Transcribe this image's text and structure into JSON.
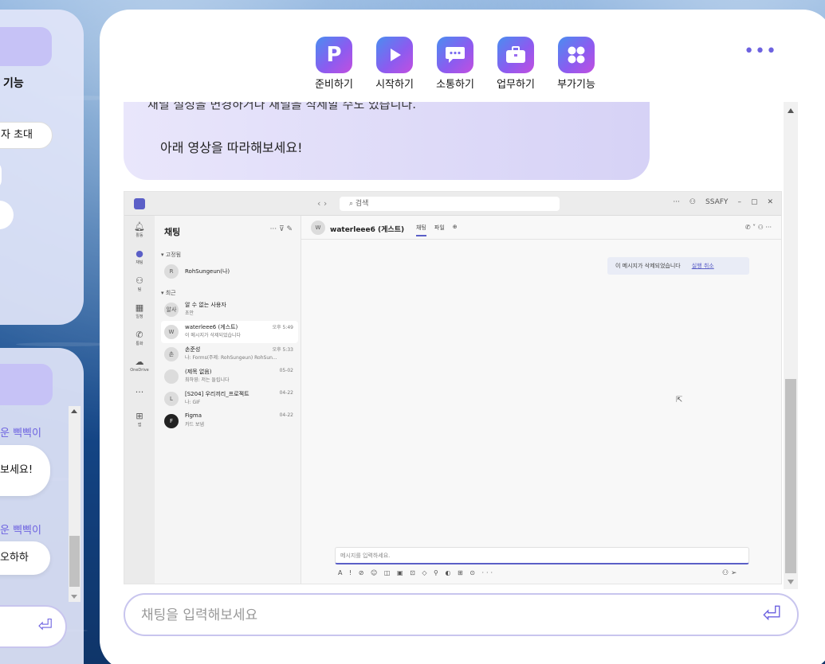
{
  "left_panel_top": {
    "feature_label": "기능",
    "invite_label": "자 초대"
  },
  "left_panel_bottom": {
    "sender1": "운 삑삑이",
    "message1": "보세요!",
    "sender2": "운 삑삑이",
    "message2": "오하하"
  },
  "nav": [
    {
      "label": "준비하기",
      "icon": "p-icon"
    },
    {
      "label": "시작하기",
      "icon": "play-icon"
    },
    {
      "label": "소통하기",
      "icon": "chat-icon"
    },
    {
      "label": "업무하기",
      "icon": "briefcase-icon"
    },
    {
      "label": "부가기능",
      "icon": "apps-icon"
    }
  ],
  "more_label": "•••",
  "message": {
    "cut_text": "채널 설정을 변경하거나 채널을 삭제할 수도 있습니다.",
    "text": "아래 영상을 따라해보세요!"
  },
  "teams": {
    "search": "검색",
    "account": "SSAFY",
    "rail": [
      "활동",
      "채팅",
      "팀",
      "일정",
      "통화",
      "OneDrive",
      "앱"
    ],
    "list_title": "채팅",
    "section_pinned": "▾ 고정됨",
    "section_recent": "▾ 최근",
    "pinned": [
      {
        "initial": "R",
        "name": "RohSungeun(나)",
        "sub": "",
        "time": ""
      }
    ],
    "recent": [
      {
        "initial": "알사",
        "name": "알 수 없는 사용자",
        "sub": "초안",
        "time": ""
      },
      {
        "initial": "W",
        "name": "waterleee6 (게스트)",
        "sub": "이 메시지가 삭제되었습니다",
        "time": "오후 5:49"
      },
      {
        "initial": "손",
        "name": "손준성",
        "sub": "나: Forms(주제: RohSungeun) RohSun...",
        "time": "오후 5:33"
      },
      {
        "initial": "",
        "name": "(제목 없음)",
        "sub": "최하영: 저는 들립니다",
        "time": "05-02"
      },
      {
        "initial": "L",
        "name": "[S204] 우리끼리_프로젝트",
        "sub": "나: GIF",
        "time": "04-22"
      },
      {
        "initial": "F",
        "name": "Figma",
        "sub": "카드 보냄",
        "time": "04-22"
      }
    ],
    "conv_name": "waterleee6 (게스트)",
    "tab_chat": "채팅",
    "tab_files": "파일",
    "deleted_msg": "이 메시지가 삭제되었습니다",
    "undo": "실행 취소",
    "compose_placeholder": "메시지를 입력하세요."
  },
  "chat_input": {
    "placeholder": "채팅을 입력해보세요"
  }
}
